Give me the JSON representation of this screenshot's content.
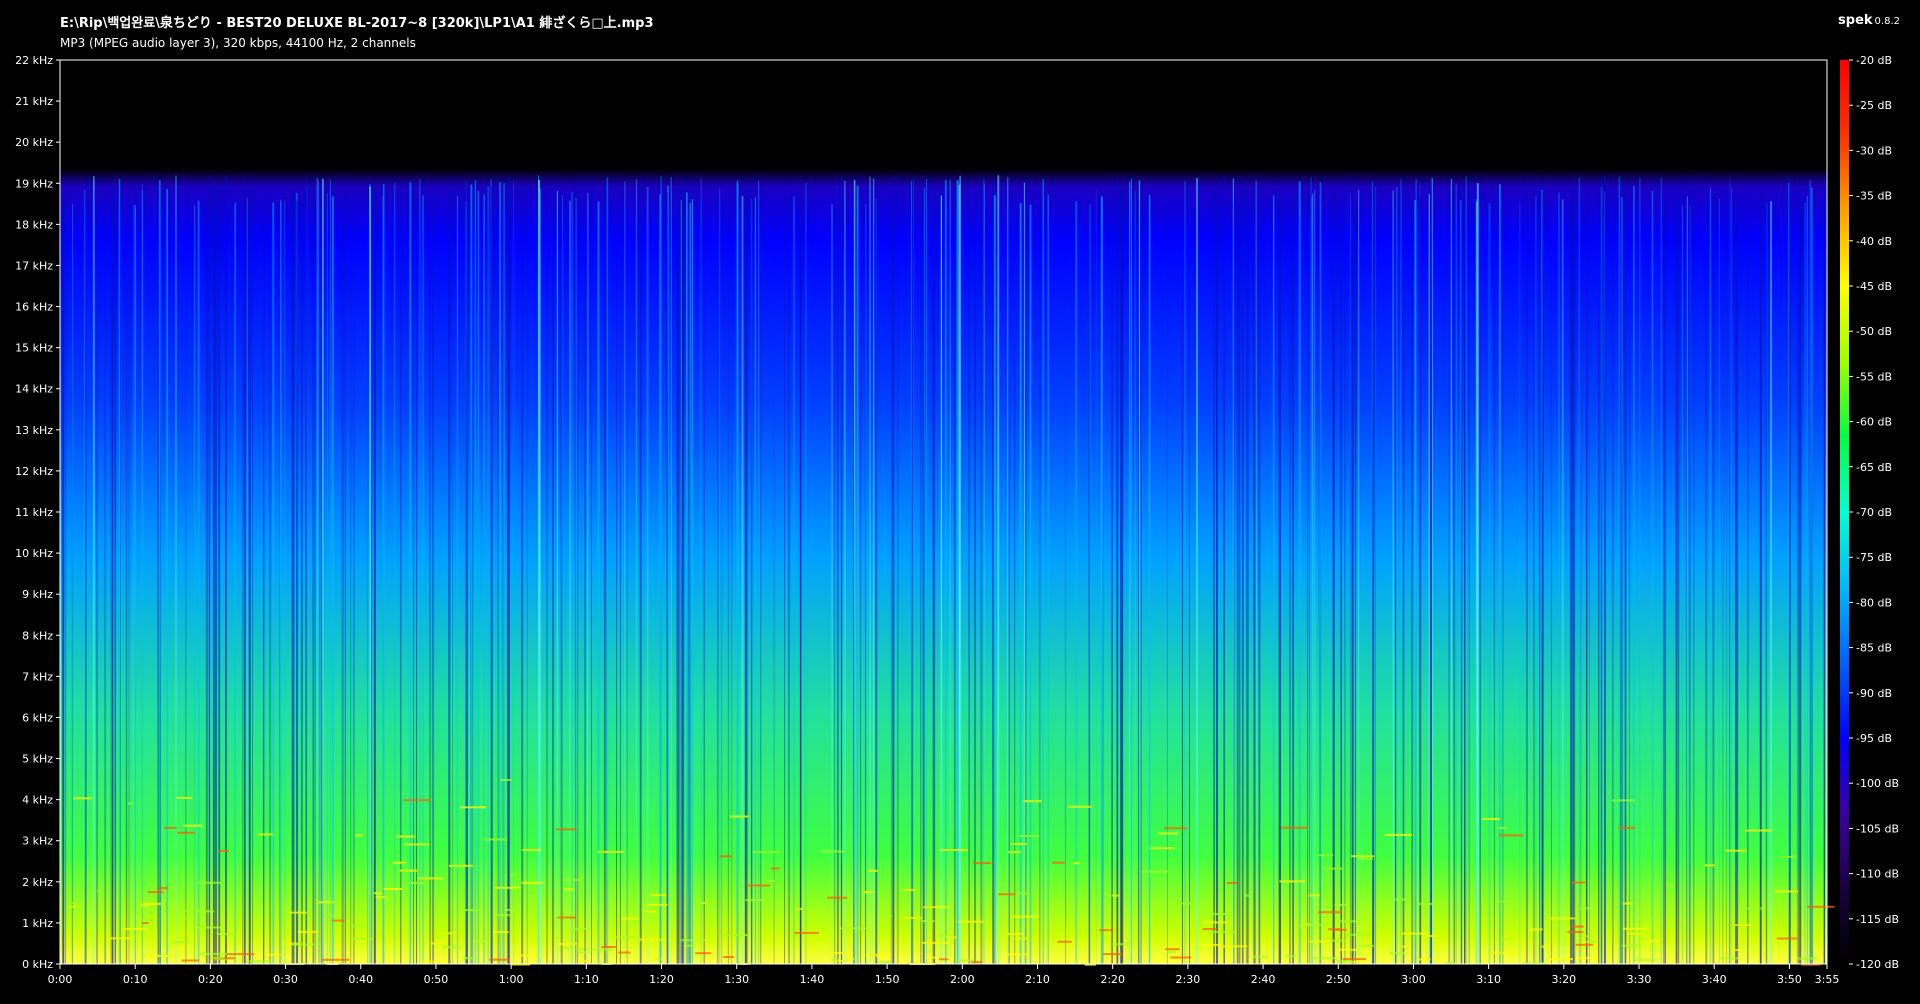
{
  "header": {
    "file_path": "E:\\Rip\\백업완료\\泉ちどり - BEST20 DELUXE BL-2017~8 [320k]\\LP1\\A1 緋ざくら□上.mp3",
    "file_info": "MP3 (MPEG audio layer 3), 320 kbps, 44100 Hz, 2 channels",
    "app_name": "spek",
    "app_version": "0.8.2"
  },
  "colors": {
    "background": "#000000",
    "text": "#ffffff",
    "axis": "#ffffff",
    "gradient": [
      "#000000",
      "#1a0040",
      "#3a00a0",
      "#0000ff",
      "#0060ff",
      "#00b8ff",
      "#00ffd0",
      "#00ff40",
      "#a0ff00",
      "#ffff00",
      "#ffa000",
      "#ff3000",
      "#ff0000"
    ]
  },
  "icons": {
    "spectrogram": "spectrogram-image",
    "color_scale": "color-scale-bar"
  },
  "chart_data": {
    "type": "heatmap",
    "title": "",
    "xlabel": "",
    "ylabel": "",
    "x_range": [
      "0:00",
      "3:55"
    ],
    "y_range": [
      "0 kHz",
      "22 kHz"
    ],
    "z_range": [
      "-120 dB",
      "-20 dB"
    ],
    "cutoff_khz": 19,
    "x_ticks": [
      "0:00",
      "0:10",
      "0:20",
      "0:30",
      "0:40",
      "0:50",
      "1:00",
      "1:10",
      "1:20",
      "1:30",
      "1:40",
      "1:50",
      "2:00",
      "2:10",
      "2:20",
      "2:30",
      "2:40",
      "2:50",
      "3:00",
      "3:10",
      "3:20",
      "3:30",
      "3:40",
      "3:50",
      "3:55"
    ],
    "x_tick_seconds": [
      0,
      10,
      20,
      30,
      40,
      50,
      60,
      70,
      80,
      90,
      100,
      110,
      120,
      130,
      140,
      150,
      160,
      170,
      180,
      190,
      200,
      210,
      220,
      230,
      235
    ],
    "y_ticks": [
      "0 kHz",
      "1 kHz",
      "2 kHz",
      "3 kHz",
      "4 kHz",
      "5 kHz",
      "6 kHz",
      "7 kHz",
      "8 kHz",
      "9 kHz",
      "10 kHz",
      "11 kHz",
      "12 kHz",
      "13 kHz",
      "14 kHz",
      "15 kHz",
      "16 kHz",
      "17 kHz",
      "18 kHz",
      "19 kHz",
      "20 kHz",
      "21 kHz",
      "22 kHz"
    ],
    "y_tick_khz": [
      0,
      1,
      2,
      3,
      4,
      5,
      6,
      7,
      8,
      9,
      10,
      11,
      12,
      13,
      14,
      15,
      16,
      17,
      18,
      19,
      20,
      21,
      22
    ],
    "db_ticks": [
      "-20 dB",
      "-25 dB",
      "-30 dB",
      "-35 dB",
      "-40 dB",
      "-45 dB",
      "-50 dB",
      "-55 dB",
      "-60 dB",
      "-65 dB",
      "-70 dB",
      "-75 dB",
      "-80 dB",
      "-85 dB",
      "-90 dB",
      "-95 dB",
      "-100 dB",
      "-105 dB",
      "-110 dB",
      "-115 dB",
      "-120 dB"
    ],
    "db_tick_values": [
      -20,
      -25,
      -30,
      -35,
      -40,
      -45,
      -50,
      -55,
      -60,
      -65,
      -70,
      -75,
      -80,
      -85,
      -90,
      -95,
      -100,
      -105,
      -110,
      -115,
      -120
    ]
  }
}
